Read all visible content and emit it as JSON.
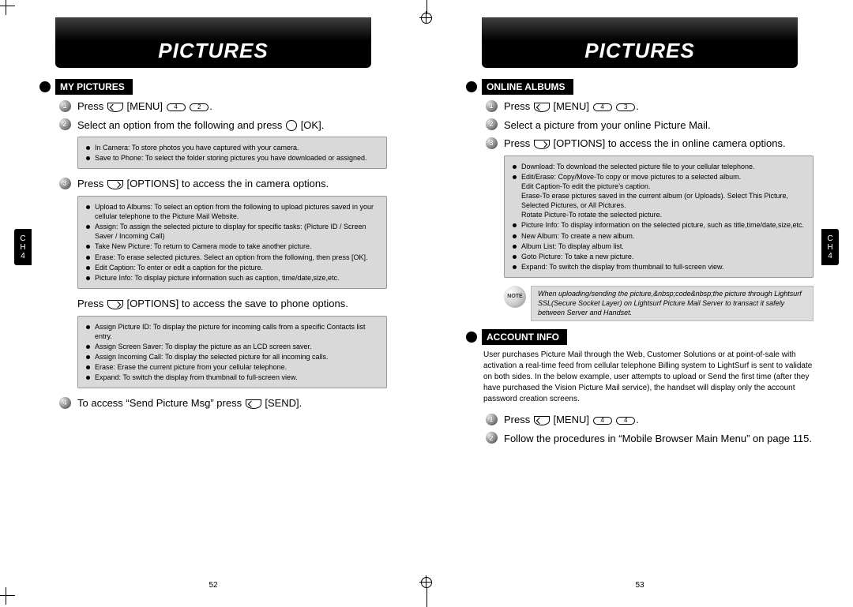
{
  "left": {
    "header": "PICTURES",
    "ch_label": "C\nH\n4",
    "section1": {
      "title": "MY PICTURES"
    },
    "steps": {
      "s1": "Press",
      "s1_menu": "[MENU]",
      "s1_keys": [
        "4",
        "2"
      ],
      "s2": "Select an option from the following and press",
      "s2_tail": "[OK].",
      "s3a": "Press",
      "s3b": "[OPTIONS] to access the in camera options.",
      "s_phone": "Press",
      "s_phone_tail": "[OPTIONS] to access the save to phone options.",
      "s4": "To access “Send Picture Msg” press",
      "s4_tail": "[SEND]."
    },
    "box1": [
      "In Camera: To store photos you have captured with your camera.",
      "Save to Phone: To select the folder storing pictures you have downloaded or assigned."
    ],
    "box2": [
      "Upload to Albums: To select an option from the following to upload pictures saved in your cellular telephone to the Picture Mail Website.",
      "Assign: To assign the selected picture to display for specific tasks: (Picture ID / Screen Saver / Incoming Call)",
      "Take New Picture: To return to Camera mode to take another picture.",
      "Erase: To erase selected pictures. Select an option from the following, then press        [OK].",
      "Edit Caption: To enter or edit a caption for the picture.",
      "Picture Info: To display picture information such as caption, time/date,size,etc."
    ],
    "box3": [
      "Assign Picture ID: To display the picture for incoming calls from a specific Contacts list entry.",
      "Assign Screen Saver: To display the picture as an LCD screen saver.",
      "Assign Incoming Call: To display the selected picture for all incoming calls.",
      "Erase: Erase the current picture from your cellular telephone.",
      "Expand: To switch the display from thumbnail to full-screen view."
    ],
    "pagenum": "52"
  },
  "right": {
    "header": "PICTURES",
    "ch_label": "C\nH\n4",
    "section1": {
      "title": "ONLINE ALBUMS"
    },
    "section2": {
      "title": "ACCOUNT INFO"
    },
    "steps": {
      "s1": "Press",
      "s1_menu": "[MENU]",
      "s1_keys": [
        "4",
        "3"
      ],
      "s2": "Select a picture from your online Picture Mail.",
      "s3a": "Press",
      "s3b": "[OPTIONS] to access the in online camera options.",
      "ai_s1": "Press",
      "ai_s1_menu": "[MENU]",
      "ai_s1_keys": [
        "4",
        "4"
      ],
      "ai_s2": "Follow the procedures in “Mobile Browser Main Menu” on page 115."
    },
    "box1": [
      "Download: To download the selected picture file to your cellular telephone.",
      "Edit/Erase: Copy/Move-To copy or move pictures to a selected album.\n   Edit Caption-To edit the picture’s caption.\n   Erase-To erase pictures saved in the current album (or Uploads). Select This Picture, Selected Pictures, or All Pictures.\n   Rotate Picture-To rotate the selected picture.",
      "Picture Info: To display information on the selected picture, such as title,time/date,size,etc.",
      "New Album: To create a new album.",
      "Album List: To display album list.",
      "Goto Picture: To take a new picture.",
      "Expand: To switch the display from thumbnail to full-screen view."
    ],
    "note": "When uploading/sending the picture,&nbsp;code&nbsp;the picture through Lightsurf SSL(Secure Socket Layer) on Lightsurf Picture Mail Server to transact it safely between Server and Handset.",
    "account_para": "User purchases Picture Mail through the Web, Customer Solutions or at point-of-sale with activation a real-time feed from cellular telephone Billing system to LightSurf is sent to validate on both sides. In the below example, user attempts to upload or Send the first time (after they have purchased the Vision Picture Mail service), the handset will display only the account password creation screens.",
    "pagenum": "53"
  }
}
